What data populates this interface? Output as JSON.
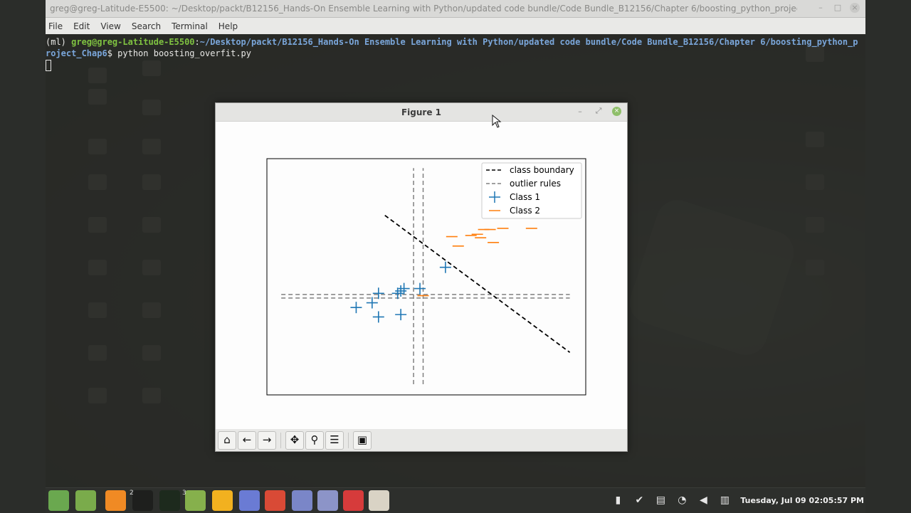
{
  "terminal": {
    "title": "greg@greg-Latitude-E5500: ~/Desktop/packt/B12156_Hands-On Ensemble Learning with Python/updated code bundle/Code Bundle_B12156/Chapter 6/boosting_python_projec...",
    "menu": [
      "File",
      "Edit",
      "View",
      "Search",
      "Terminal",
      "Help"
    ],
    "prompt_env": "(ml) ",
    "prompt_user": "greg@greg-Latitude-E5500",
    "prompt_sep": ":",
    "prompt_path_line1": "~/Desktop/packt/B12156_Hands-On Ensemble Learning with Python/updated code bundle/Code Bundle_B12156/Chapter 6/boosting_python_p",
    "prompt_path_line2": "roject_Chap6",
    "prompt_dollar": "$ ",
    "command": "python boosting_overfit.py"
  },
  "figure": {
    "title": "Figure 1",
    "toolbar": [
      "home-icon",
      "back-icon",
      "forward-icon",
      "pan-icon",
      "zoom-icon",
      "configure-icon",
      "save-icon"
    ]
  },
  "chart_data": {
    "type": "scatter",
    "title": "",
    "xlabel": "",
    "ylabel": "",
    "xlim": [
      0,
      10
    ],
    "ylim": [
      0,
      10
    ],
    "grid": false,
    "legend_placement": "top-right",
    "legend": [
      {
        "label": "class boundary",
        "style": "dashed",
        "color": "#000000"
      },
      {
        "label": "outlier rules",
        "style": "dashed",
        "color": "#808080"
      },
      {
        "label": "Class 1",
        "marker": "+",
        "color": "#1f77b4"
      },
      {
        "label": "Class 2",
        "marker": "_",
        "color": "#ff7f0e"
      }
    ],
    "class_boundary": {
      "x": [
        3.7,
        9.5
      ],
      "y": [
        7.6,
        1.8
      ]
    },
    "outlier_rules": {
      "vertical": [
        {
          "x": 4.6,
          "y": [
            0.45,
            9.6
          ]
        },
        {
          "x": 4.9,
          "y": [
            0.45,
            9.6
          ]
        }
      ],
      "horizontal": [
        {
          "y": 4.25,
          "x": [
            0.45,
            9.5
          ]
        },
        {
          "y": 4.1,
          "x": [
            0.45,
            9.5
          ]
        }
      ]
    },
    "series": [
      {
        "name": "Class 1",
        "color": "#1f77b4",
        "points": [
          [
            2.8,
            3.7
          ],
          [
            3.3,
            3.9
          ],
          [
            3.5,
            4.3
          ],
          [
            3.5,
            3.3
          ],
          [
            4.1,
            4.3
          ],
          [
            4.2,
            4.4
          ],
          [
            4.3,
            4.5
          ],
          [
            4.2,
            3.4
          ],
          [
            4.8,
            4.5
          ],
          [
            5.6,
            5.4
          ]
        ]
      },
      {
        "name": "Class 2",
        "color": "#ff7f0e",
        "points": [
          [
            4.9,
            4.2
          ],
          [
            5.8,
            6.7
          ],
          [
            6.0,
            6.3
          ],
          [
            6.4,
            6.75
          ],
          [
            6.6,
            6.8
          ],
          [
            6.7,
            6.65
          ],
          [
            6.8,
            7.0
          ],
          [
            7.0,
            7.0
          ],
          [
            7.1,
            6.45
          ],
          [
            7.4,
            7.05
          ],
          [
            8.3,
            7.05
          ]
        ]
      }
    ]
  },
  "taskbar": {
    "apps": [
      {
        "name": "mint-menu-icon",
        "color": "#6aa84f"
      },
      {
        "name": "files-icon",
        "color": "#7aab4b"
      },
      {
        "name": "firefox-icon",
        "color": "#f08a24"
      },
      {
        "name": "terminal-icon",
        "color": "#1e1f1d",
        "badge": "2"
      },
      {
        "name": "system-monitor-icon",
        "color": "#1d2a1d"
      },
      {
        "name": "folder-icon",
        "color": "#86b04c",
        "badge": "3"
      },
      {
        "name": "app-yellow-icon",
        "color": "#f2b11f"
      },
      {
        "name": "discord-icon",
        "color": "#6a7bd4"
      },
      {
        "name": "chrome-icon",
        "color": "#d94a36"
      },
      {
        "name": "notes-icon",
        "color": "#7a86c8"
      },
      {
        "name": "document-icon",
        "color": "#8c94c8"
      },
      {
        "name": "ebook-icon",
        "color": "#d63b3b"
      },
      {
        "name": "python-figure-icon",
        "color": "#d9d3c5"
      }
    ],
    "clock": "Tuesday, Jul 09 02:05:57 PM"
  }
}
